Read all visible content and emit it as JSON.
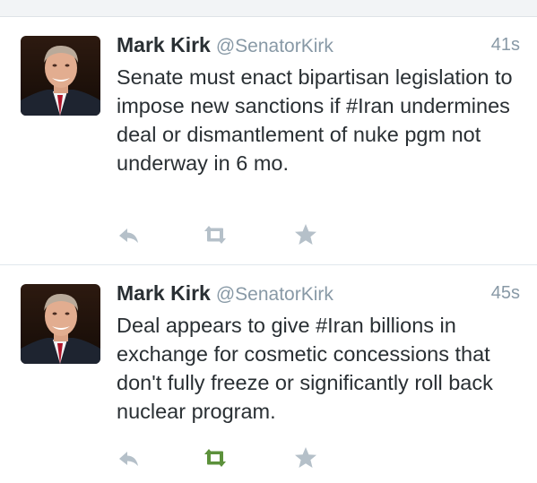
{
  "colors": {
    "name": "#292f33",
    "muted": "#8899a6",
    "icon_gray": "#b5c0c9",
    "retweeted_green": "#5c913b",
    "divider": "#e1e8ed"
  },
  "tweets": [
    {
      "name": "Mark Kirk",
      "handle": "@SenatorKirk",
      "time": "41s",
      "text": "Senate must enact bipartisan legislation to impose new sanctions if #Iran undermines deal or dismantlement of nuke pgm not underway in 6 mo.",
      "retweeted": false,
      "icons": [
        "reply-icon",
        "retweet-icon",
        "favorite-star-icon"
      ]
    },
    {
      "name": "Mark Kirk",
      "handle": "@SenatorKirk",
      "time": "45s",
      "text": "Deal appears to give #Iran billions in exchange for cosmetic concessions that don't fully freeze or significantly roll back nuclear program.",
      "retweeted": true,
      "icons": [
        "reply-icon",
        "retweet-icon",
        "favorite-star-icon"
      ]
    }
  ]
}
